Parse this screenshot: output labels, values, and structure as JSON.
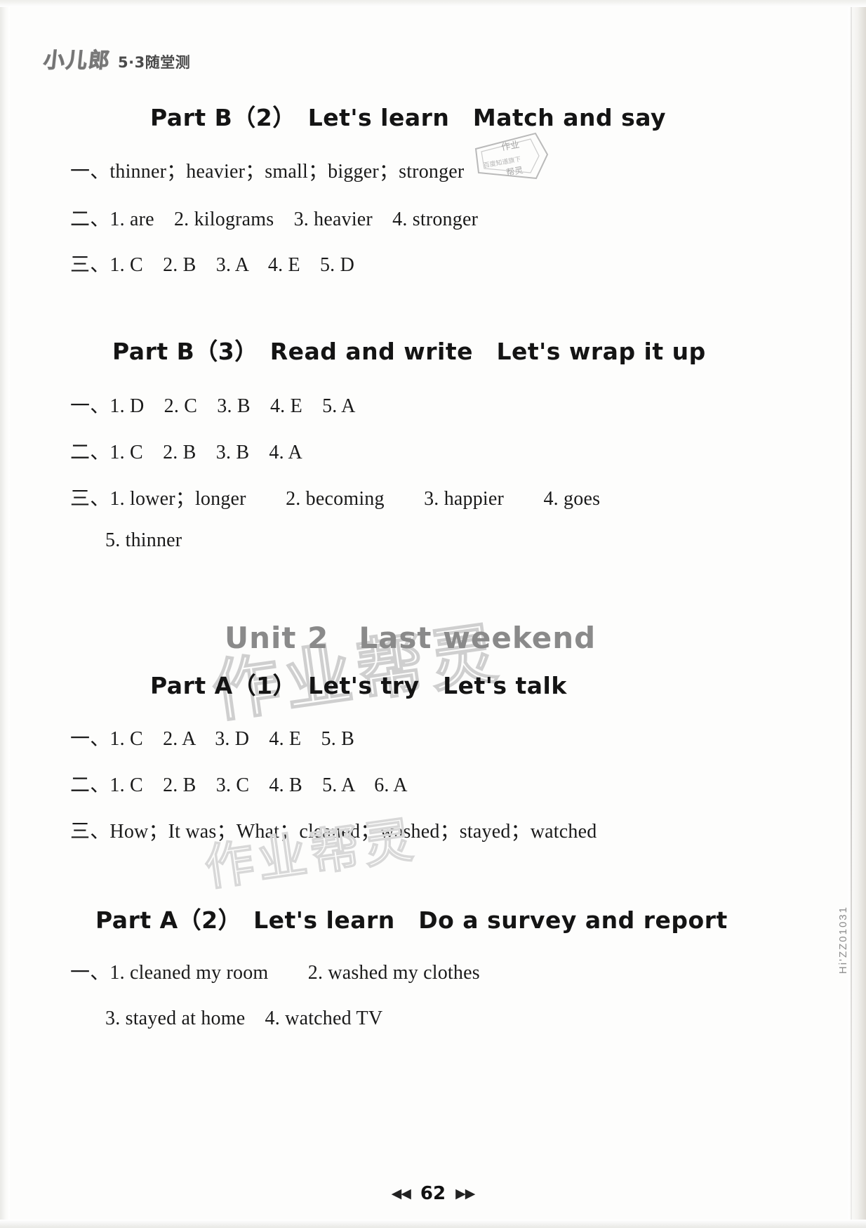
{
  "masthead": {
    "logo_text": "小儿郎",
    "logo_sub": "5·3随堂测"
  },
  "watermark": {
    "text": "作业帮灵",
    "stamp_text": "作业"
  },
  "sections": [
    {
      "heading": "Part B（2）　Let's learn　Match and say",
      "answers": [
        "一、thinner；heavier；small；bigger；stronger",
        "二、1. are　2. kilograms　3. heavier　4. stronger",
        "三、1. C　2. B　3. A　4. E　5. D"
      ]
    },
    {
      "heading": "Part B（3）　Read and write　Let's wrap it up",
      "answers": [
        "一、1. D　2. C　3. B　4. E　5. A",
        "二、1. C　2. B　3. B　4. A",
        "三、1. lower；longer　　2. becoming　　3. happier　　4. goes",
        "5. thinner"
      ]
    }
  ],
  "unit": {
    "title": "Unit 2　Last weekend",
    "sections": [
      {
        "heading": "Part A（1）　Let's try　Let's talk",
        "answers": [
          "一、1. C　2. A　3. D　4. E　5. B",
          "二、1. C　2. B　3. C　4. B　5. A　6. A",
          "三、How；It was；What；cleaned；washed；stayed；watched"
        ]
      },
      {
        "heading": "Part A（2）　Let's learn　Do a survey and report",
        "answers": [
          "一、1. cleaned my room　　2. washed my clothes",
          "3. stayed at home　4. watched TV"
        ]
      }
    ]
  },
  "side_code": "Hi'ZZ01031",
  "footer": {
    "prev_arrows": "◀◀",
    "page_number": "62",
    "next_arrows": "▶▶"
  }
}
